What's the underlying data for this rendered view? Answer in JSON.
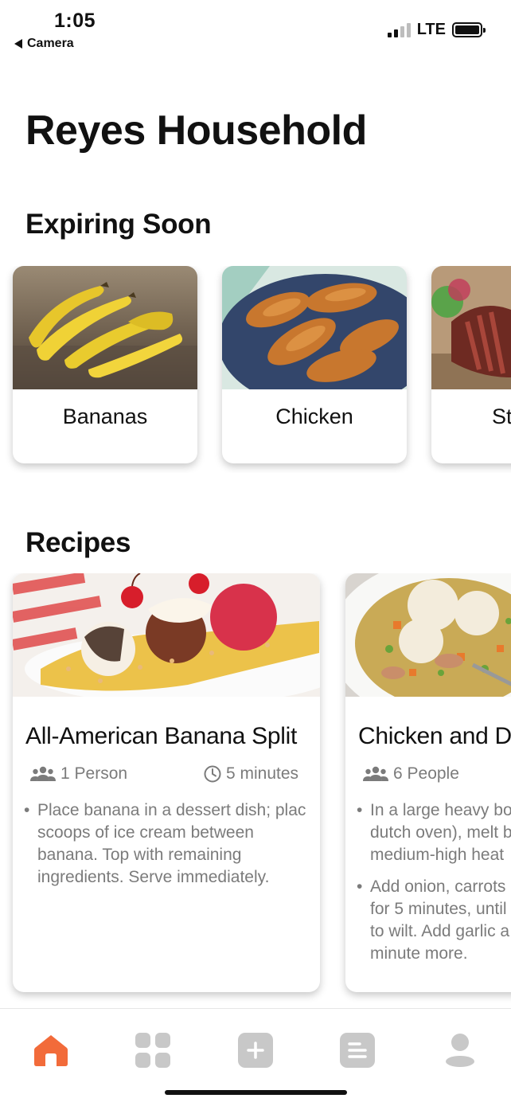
{
  "status_bar": {
    "time": "1:05",
    "back_label": "Camera",
    "network": "LTE"
  },
  "page_title": "Reyes Household",
  "sections": {
    "expiring": "Expiring Soon",
    "recipes": "Recipes"
  },
  "expiring_items": [
    {
      "name": "Bananas"
    },
    {
      "name": "Chicken"
    },
    {
      "name": "St"
    }
  ],
  "recipes": [
    {
      "title": "All-American Banana Split",
      "servings": "1 Person",
      "time": "5 minutes",
      "steps": [
        "Place banana in a dessert dish; plac\nscoops of ice cream between\nbanana. Top with remaining\ningredients. Serve immediately."
      ]
    },
    {
      "title": "Chicken and D",
      "servings": "6 People",
      "steps": [
        "In a large heavy bo\ndutch oven), melt b\nmedium-high heat",
        "Add onion, carrots\nfor 5 minutes, until\nto wilt. Add garlic a\nminute more."
      ]
    }
  ],
  "tabs": [
    {
      "name": "home",
      "icon": "home-icon",
      "active": true
    },
    {
      "name": "categories",
      "icon": "grid-icon",
      "active": false
    },
    {
      "name": "add",
      "icon": "plus-icon",
      "active": false
    },
    {
      "name": "list",
      "icon": "list-icon",
      "active": false
    },
    {
      "name": "profile",
      "icon": "person-icon",
      "active": false
    }
  ],
  "colors": {
    "accent": "#F26B3A",
    "inactive_icon": "#C8C8C8",
    "meta_text": "#7B7B7B"
  }
}
